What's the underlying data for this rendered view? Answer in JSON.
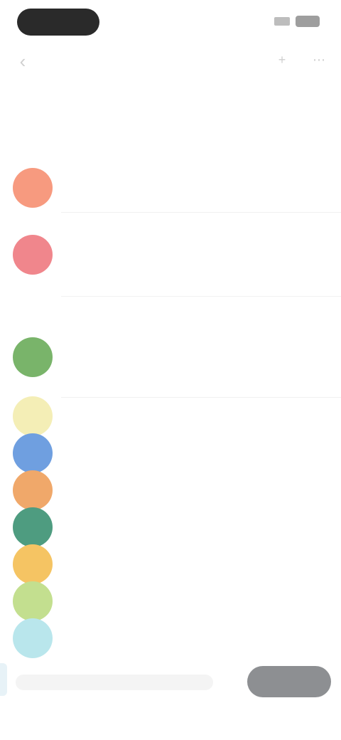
{
  "status_bar": {},
  "nav": {
    "back_icon": "back-arrow-icon",
    "title": "",
    "action_icons": [
      "add-icon",
      "more-icon"
    ]
  },
  "hint": "",
  "section_title": "",
  "group_label": "",
  "contacts": [
    {
      "name": "",
      "subtitle": "",
      "color": "#f79a7f"
    },
    {
      "name": "",
      "subtitle": "",
      "note": "",
      "color": "#f0868c"
    },
    {
      "name": "",
      "subtitle": "",
      "note": "",
      "color": "#79b46a"
    },
    {
      "name": "",
      "subtitle": "",
      "color": "#f4eeb6"
    },
    {
      "name": "",
      "subtitle": "",
      "color": "#6f9fe0"
    },
    {
      "name": "",
      "subtitle": "",
      "color": "#f0a86a"
    },
    {
      "name": "",
      "subtitle": "",
      "color": "#4e9c80"
    },
    {
      "name": "",
      "subtitle": "",
      "color": "#f5c463"
    },
    {
      "name": "",
      "subtitle": "",
      "color": "#c3df8f"
    },
    {
      "name": "",
      "subtitle": "",
      "color": "#b9e6ec"
    }
  ],
  "bottom": {
    "input_placeholder": "",
    "button_label": ""
  }
}
